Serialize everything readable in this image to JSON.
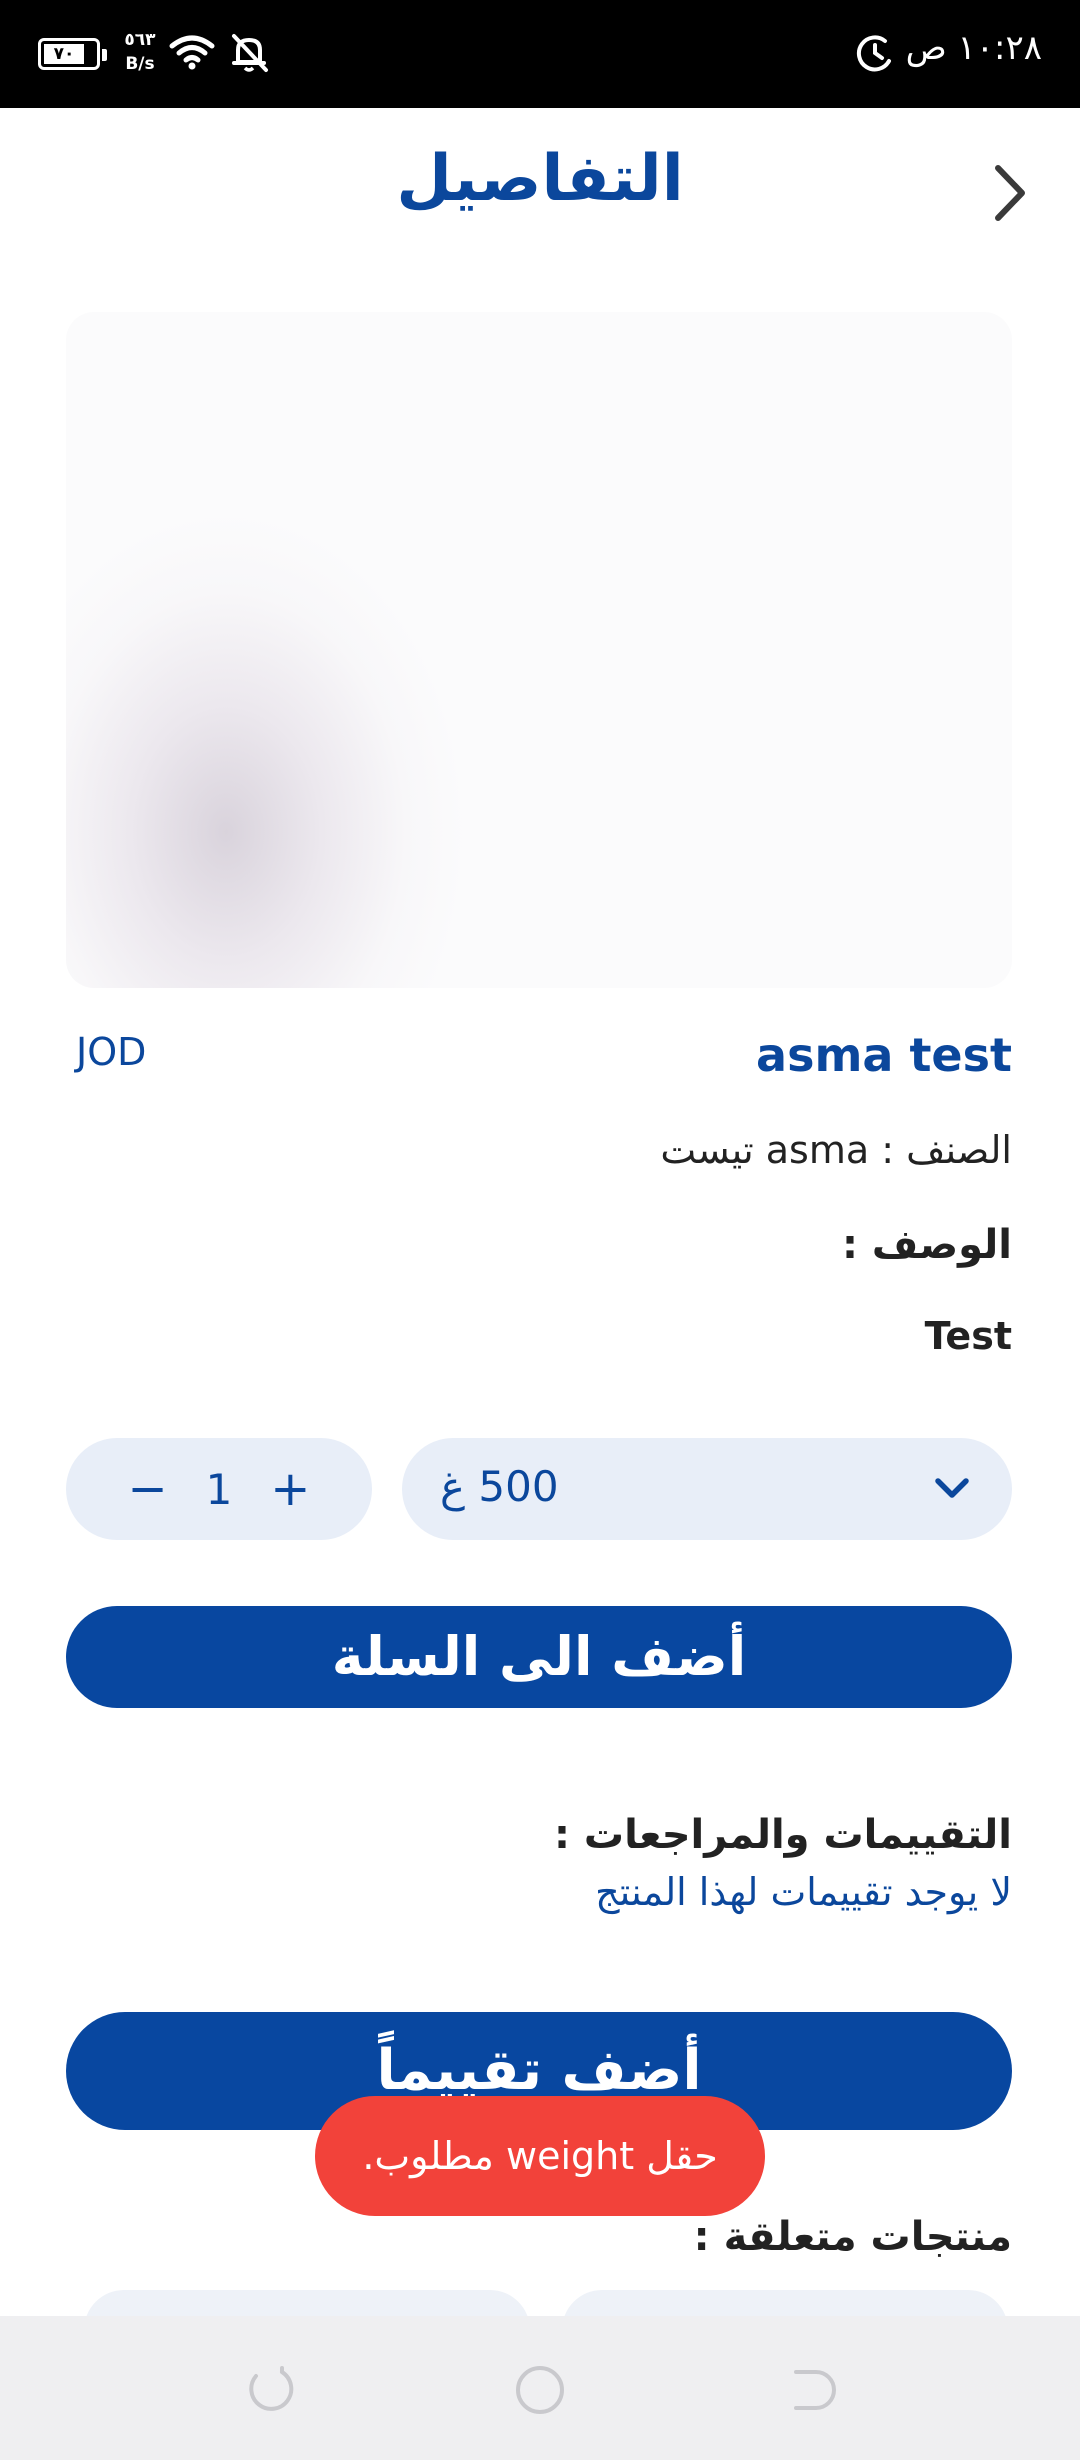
{
  "status_bar": {
    "time": "١٠:٢٨ ص",
    "battery": "٧٠",
    "net_speed_value": "٥٦٣",
    "net_speed_unit": "B/s"
  },
  "header": {
    "title": "التفاصيل"
  },
  "product": {
    "name": "asma test",
    "currency": "JOD",
    "category_line": "الصنف : asma تيست",
    "description_label": "الوصف :",
    "description": "Test"
  },
  "options": {
    "weight_selected": "500 غ",
    "quantity": "1",
    "minus_symbol": "−",
    "plus_symbol": "+"
  },
  "actions": {
    "add_to_cart": "أضف الى السلة",
    "add_review": "أضف تقييماً"
  },
  "reviews": {
    "label": "التقييمات والمراجعات :",
    "empty_text": "لا يوجد تقييمات لهذا المنتج"
  },
  "related": {
    "label": "منتجات متعلقة :"
  },
  "toast": {
    "message": "حقل weight مطلوب."
  },
  "colors": {
    "primary": "#0847a0",
    "title_blue": "#0b479c",
    "field_bg": "#e8eef8",
    "toast_red": "#f2423a"
  }
}
